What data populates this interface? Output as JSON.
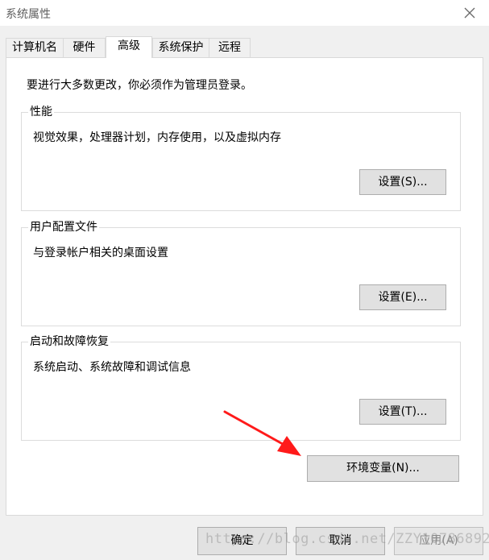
{
  "window": {
    "title": "系统属性",
    "close_icon": "close-icon"
  },
  "tabs": [
    {
      "label": "计算机名",
      "active": false
    },
    {
      "label": "硬件",
      "active": false
    },
    {
      "label": "高级",
      "active": true
    },
    {
      "label": "系统保护",
      "active": false
    },
    {
      "label": "远程",
      "active": false
    }
  ],
  "panel": {
    "intro": "要进行大多数更改，你必须作为管理员登录。",
    "groups": [
      {
        "legend": "性能",
        "description": "视觉效果，处理器计划，内存使用，以及虚拟内存",
        "button": "设置(S)..."
      },
      {
        "legend": "用户配置文件",
        "description": "与登录帐户相关的桌面设置",
        "button": "设置(E)..."
      },
      {
        "legend": "启动和故障恢复",
        "description": "系统启动、系统故障和调试信息",
        "button": "设置(T)..."
      }
    ],
    "env_button": "环境变量(N)..."
  },
  "footer": {
    "ok": "确定",
    "cancel": "取消",
    "apply": "应用(A)",
    "apply_disabled": true
  },
  "annotation": {
    "arrow_color": "#ff1a1a"
  },
  "watermark": "https://blog.csdn.net/ZZY1078689276"
}
